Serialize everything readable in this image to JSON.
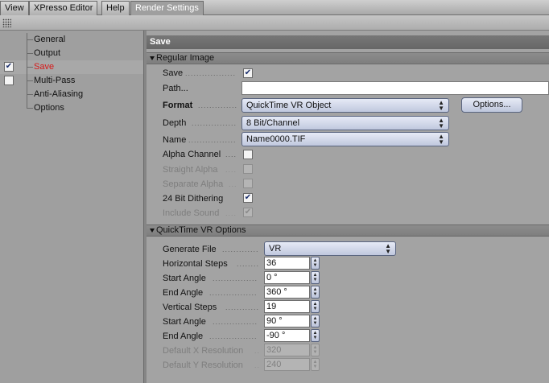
{
  "tabs": [
    {
      "label": "View",
      "active": false
    },
    {
      "label": "XPresso Editor",
      "active": false
    },
    {
      "label": "Help",
      "active": false
    },
    {
      "label": "Render Settings",
      "active": true
    }
  ],
  "toolbar": {
    "grip_icon": "grip-icon"
  },
  "nav": {
    "items": [
      {
        "label": "General",
        "checkbox": null
      },
      {
        "label": "Output",
        "checkbox": null
      },
      {
        "label": "Save",
        "checkbox": true,
        "current": true
      },
      {
        "label": "Multi-Pass",
        "checkbox": false
      },
      {
        "label": "Anti-Aliasing",
        "checkbox": null
      },
      {
        "label": "Options",
        "checkbox": null
      }
    ]
  },
  "panel": {
    "title": "Save",
    "regular_image": {
      "header": "Regular Image",
      "save_label": "Save",
      "save_checked": true,
      "path_label": "Path...",
      "path_value": "",
      "format_label": "Format",
      "format_value": "QuickTime VR Object",
      "options_button": "Options...",
      "depth_label": "Depth",
      "depth_value": "8 Bit/Channel",
      "name_label": "Name",
      "name_value": "Name0000.TIF",
      "alpha_label": "Alpha Channel",
      "alpha_checked": false,
      "straight_alpha_label": "Straight Alpha",
      "separate_alpha_label": "Separate Alpha",
      "dithering_label": "24 Bit Dithering",
      "dithering_checked": true,
      "include_sound_label": "Include Sound",
      "include_sound_checked": true
    },
    "qtvr": {
      "header": "QuickTime VR Options",
      "generate_label": "Generate File",
      "generate_value": "VR",
      "h_steps_label": "Horizontal Steps",
      "h_steps_value": "36",
      "start_angle_label": "Start Angle",
      "start_angle_value": "0 °",
      "end_angle_label": "End Angle",
      "end_angle_value": "360 °",
      "v_steps_label": "Vertical Steps",
      "v_steps_value": "19",
      "start_angle2_label": "Start Angle",
      "start_angle2_value": "90 °",
      "end_angle2_label": "End Angle",
      "end_angle2_value": "-90 °",
      "def_x_label": "Default X Resolution",
      "def_x_value": "320",
      "def_y_label": "Default Y Resolution",
      "def_y_value": "240"
    }
  },
  "colors": {
    "current_item": "#d81818",
    "panel_bg": "#a3a3a3",
    "header_bg": "#6d6d6d",
    "control_accent": "#c0c8de"
  }
}
